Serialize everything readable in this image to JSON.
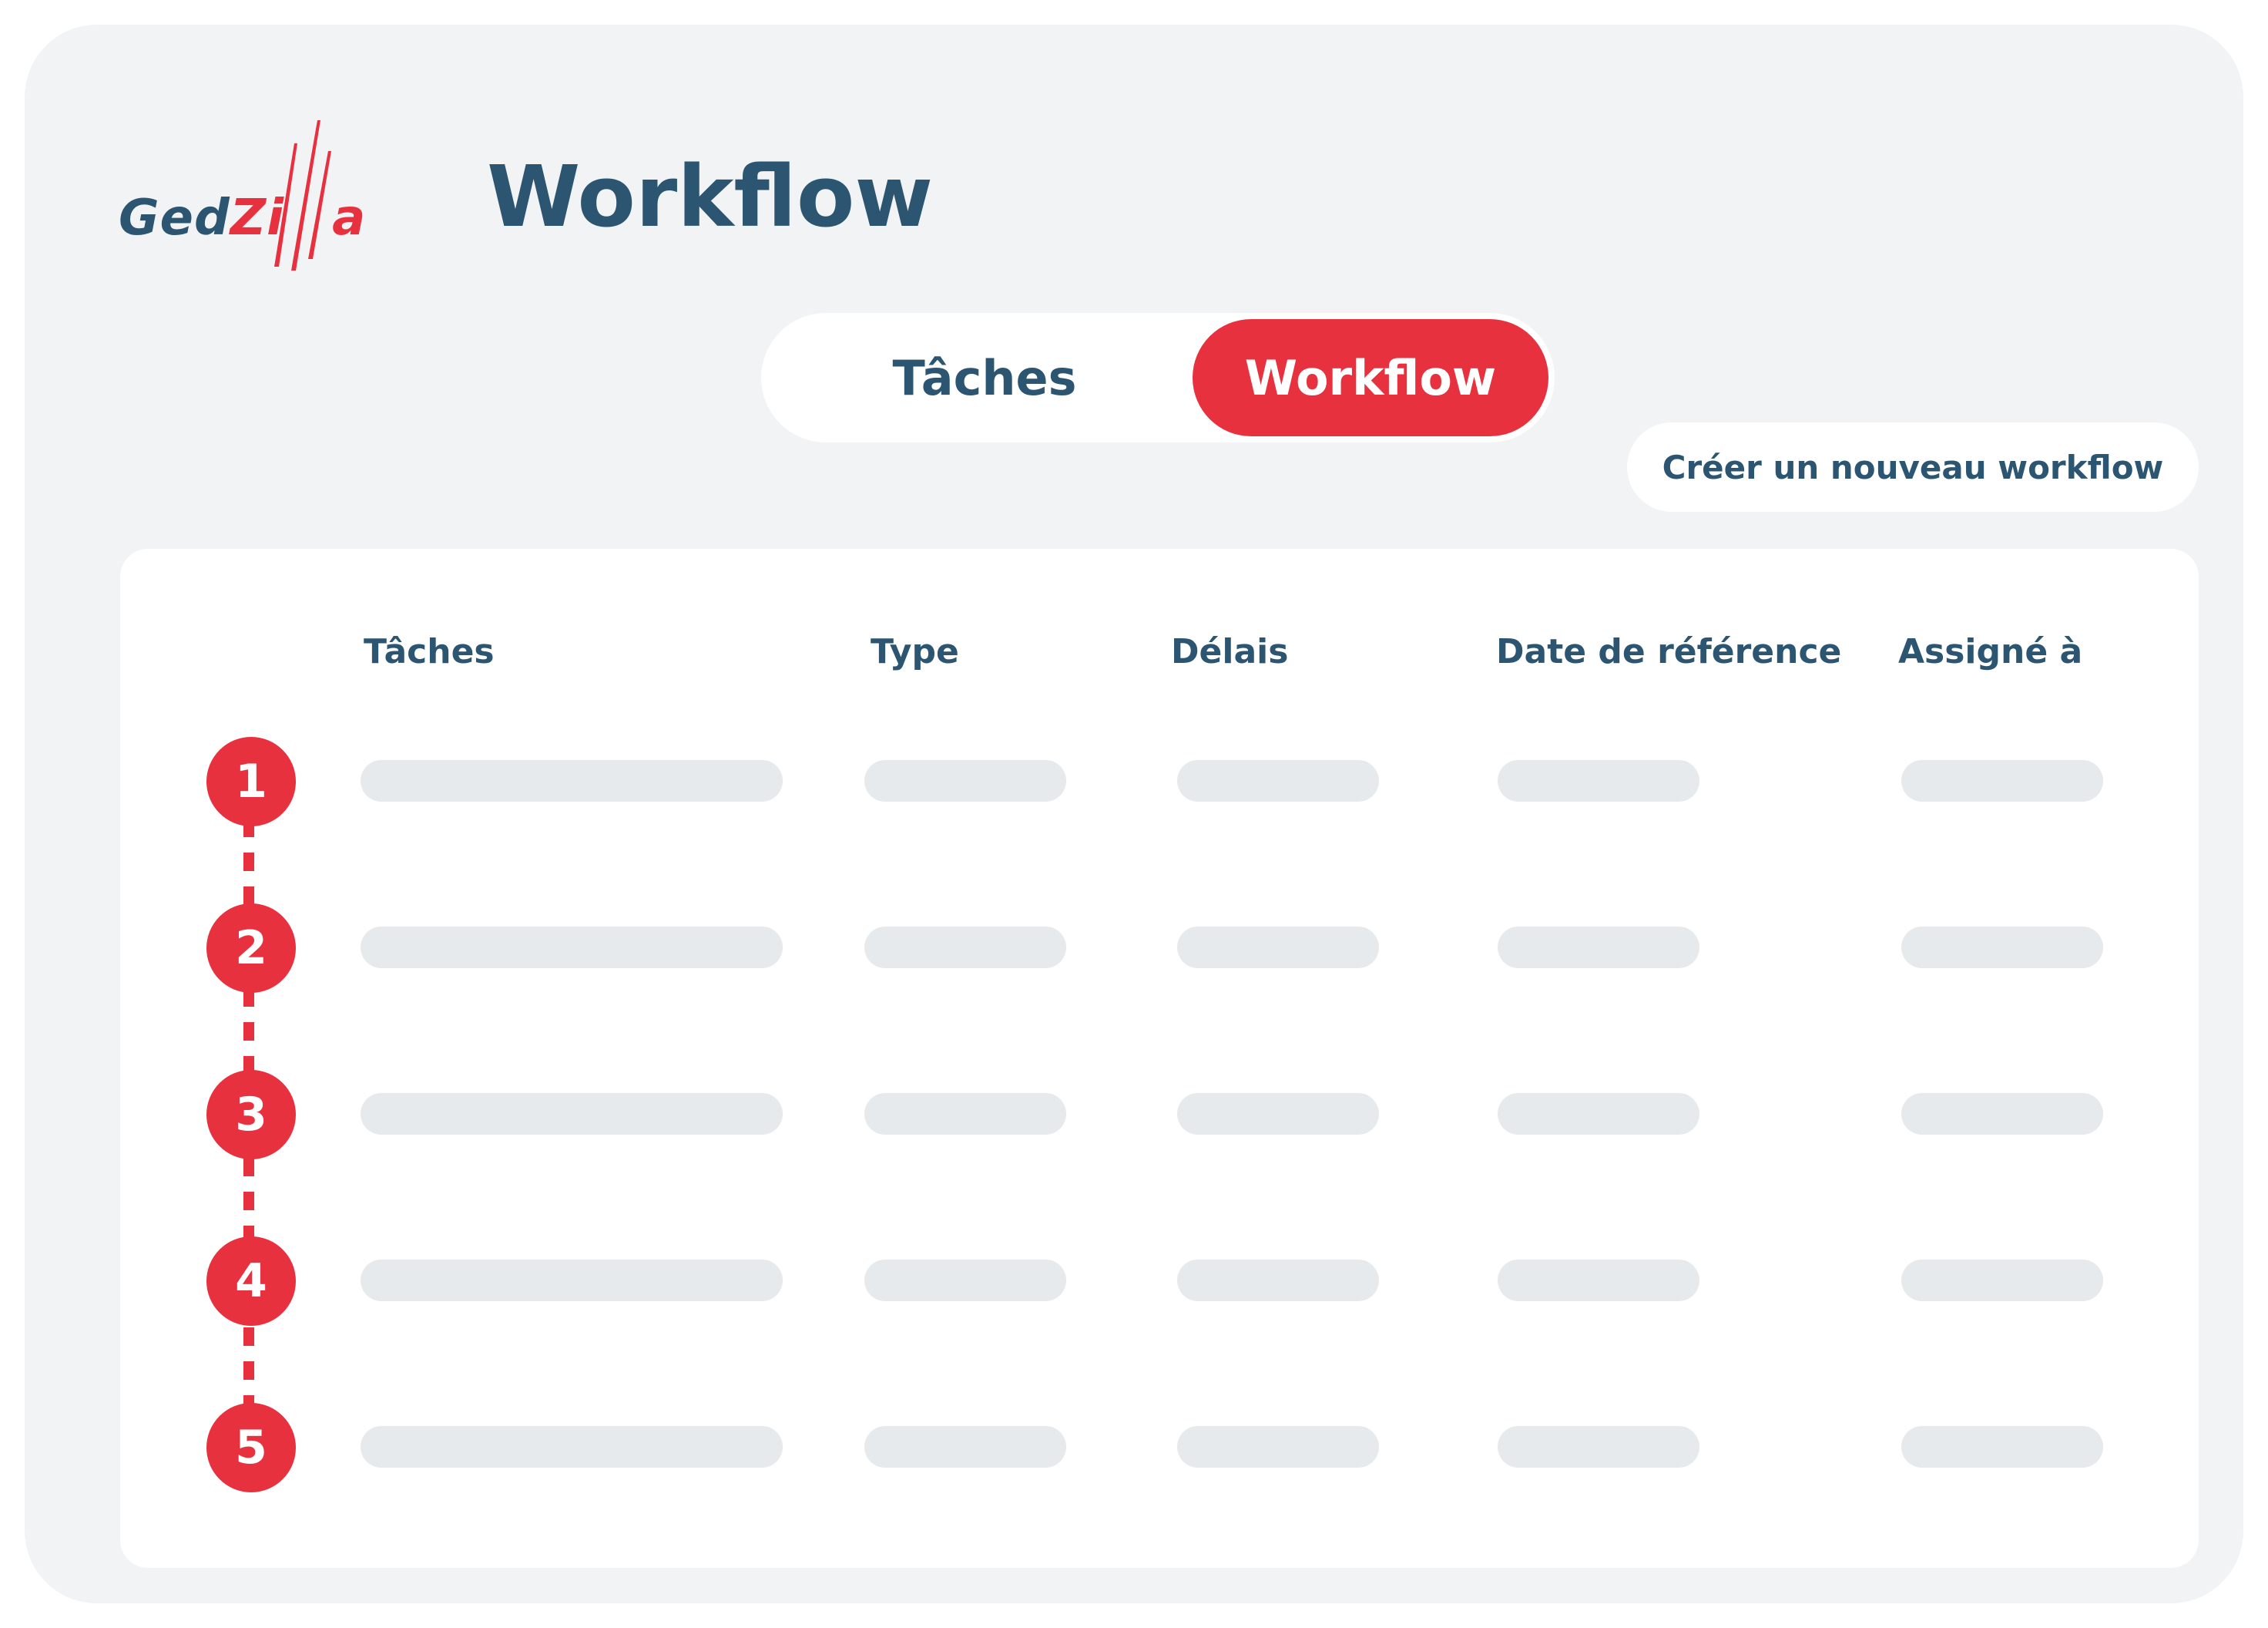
{
  "logo": {
    "part1": "Ged",
    "part2": "Zi",
    "part3": "a"
  },
  "page_title": "Workflow",
  "tabs": [
    {
      "label": "Tâches",
      "active": false
    },
    {
      "label": "Workflow",
      "active": true
    }
  ],
  "create_button": "Créer un nouveau workflow",
  "table": {
    "columns": [
      "Tâches",
      "Type",
      "Délais",
      "Date de référence",
      "Assigné à"
    ],
    "steps": [
      "1",
      "2",
      "3",
      "4",
      "5"
    ]
  },
  "colors": {
    "accent": "#e8313e",
    "text": "#2b5570",
    "background": "#f2f3f5",
    "placeholder": "#e6eaec"
  }
}
